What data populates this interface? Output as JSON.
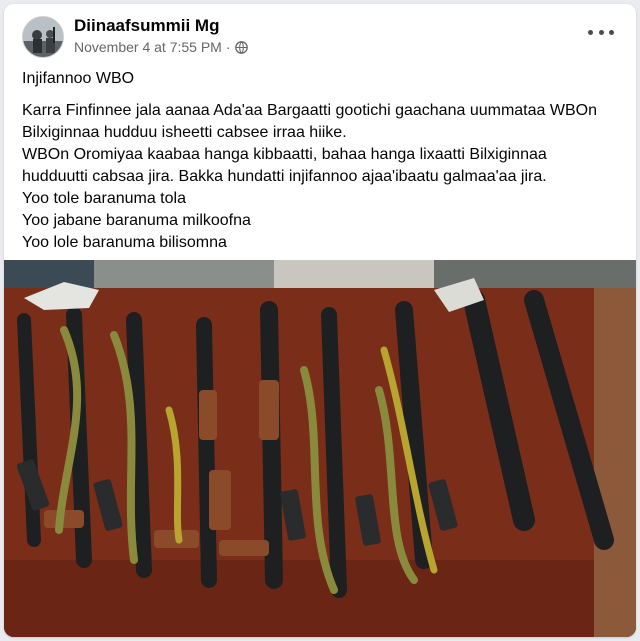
{
  "post": {
    "author": "Diinaafsummii Mg",
    "timestamp": "November 4 at 7:55 PM",
    "separator": "·",
    "audience_icon": "globe-icon",
    "more_icon": "more-options-icon",
    "title": "Injifannoo WBO",
    "paragraph_lines": [
      "Karra Finfinnee jala aanaa Ada'aa Bargaatti gootichi gaachana uummataa WBOn",
      "Bilxiginnaa hudduu isheetti cabsee irraa hiike.",
      "WBOn Oromiyaa kaabaa hanga kibbaatti, bahaa hanga lixaatti Bilxiginnaa",
      "hudduutti cabsaa jira. Bakka hundatti injifannoo ajaa'ibaatu galmaa'aa jira.",
      "Yoo tole baranuma tola",
      "Yoo jabane baranuma milkoofna",
      "Yoo lole baranuma bilisomna"
    ]
  },
  "photo": {
    "subject": "row of rifles with green slings on a wooden table"
  },
  "colors": {
    "background": "#e9ebee",
    "card": "#ffffff",
    "text": "#050505",
    "meta": "#65676b",
    "table": "#7a2e1a"
  }
}
